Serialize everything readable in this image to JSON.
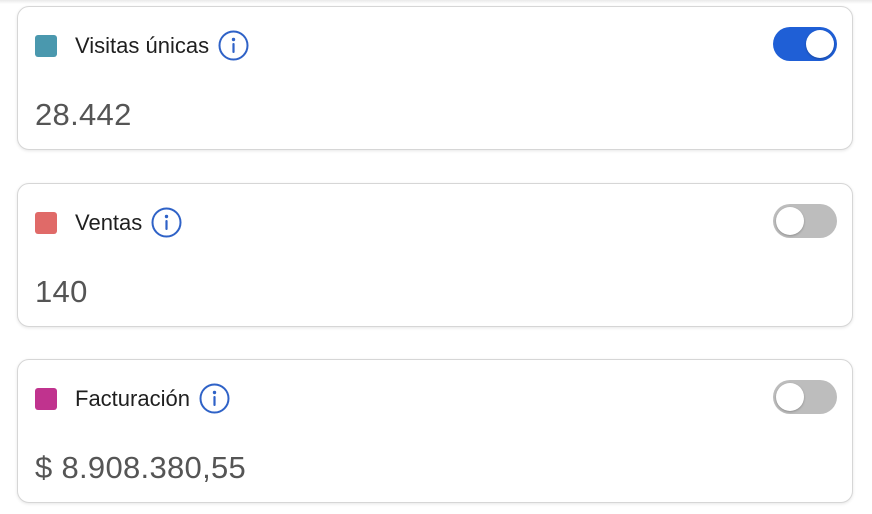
{
  "metrics": [
    {
      "label": "Visitas únicas",
      "value": "28.442",
      "color": "#4a98ae",
      "toggle_on": true,
      "icon": "info-icon"
    },
    {
      "label": "Ventas",
      "value": "140",
      "color": "#e06a68",
      "toggle_on": false,
      "icon": "info-icon"
    },
    {
      "label": "Facturación",
      "value": "$ 8.908.380,55",
      "color": "#c0338e",
      "toggle_on": false,
      "icon": "info-icon"
    }
  ],
  "colors": {
    "accent": "#1f5fd6",
    "toggle_off": "#bdbdbd",
    "info_icon": "#2f62c7"
  }
}
